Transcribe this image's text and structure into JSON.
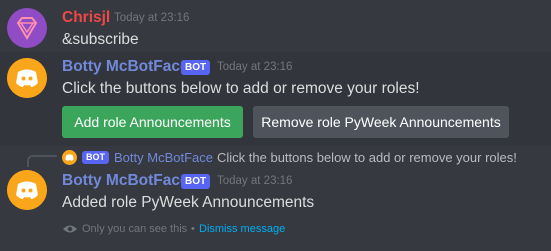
{
  "messages": [
    {
      "author": "Chrisjl",
      "author_color": "#f04747",
      "timestamp": "Today at 23:16",
      "text": "&subscribe"
    },
    {
      "author": "Botty McBotFace",
      "author_color": "#7289da",
      "bot_tag": "BOT",
      "timestamp": "Today at 23:16",
      "text": "Click the buttons below to add or remove your roles!",
      "buttons": [
        {
          "label": "Add role Announcements",
          "style": "success",
          "color": "#3ba55c"
        },
        {
          "label": "Remove role PyWeek Announcements",
          "style": "secondary",
          "color": "#4f545c"
        }
      ]
    },
    {
      "reply": {
        "bot_tag": "BOT",
        "author": "Botty McBotFace",
        "text": "Click the buttons below to add or remove your roles!"
      },
      "author": "Botty McBotFace",
      "author_color": "#7289da",
      "bot_tag": "BOT",
      "timestamp": "Today at 23:16",
      "text": "Added role PyWeek Announcements",
      "ephemeral_note": "Only you can see this",
      "separator": "•",
      "dismiss_label": "Dismiss message"
    }
  ],
  "icons": {
    "user_avatar": "diamond-logo-avatar",
    "bot_avatar": "discord-logo-avatar",
    "eye": "eye-icon"
  }
}
